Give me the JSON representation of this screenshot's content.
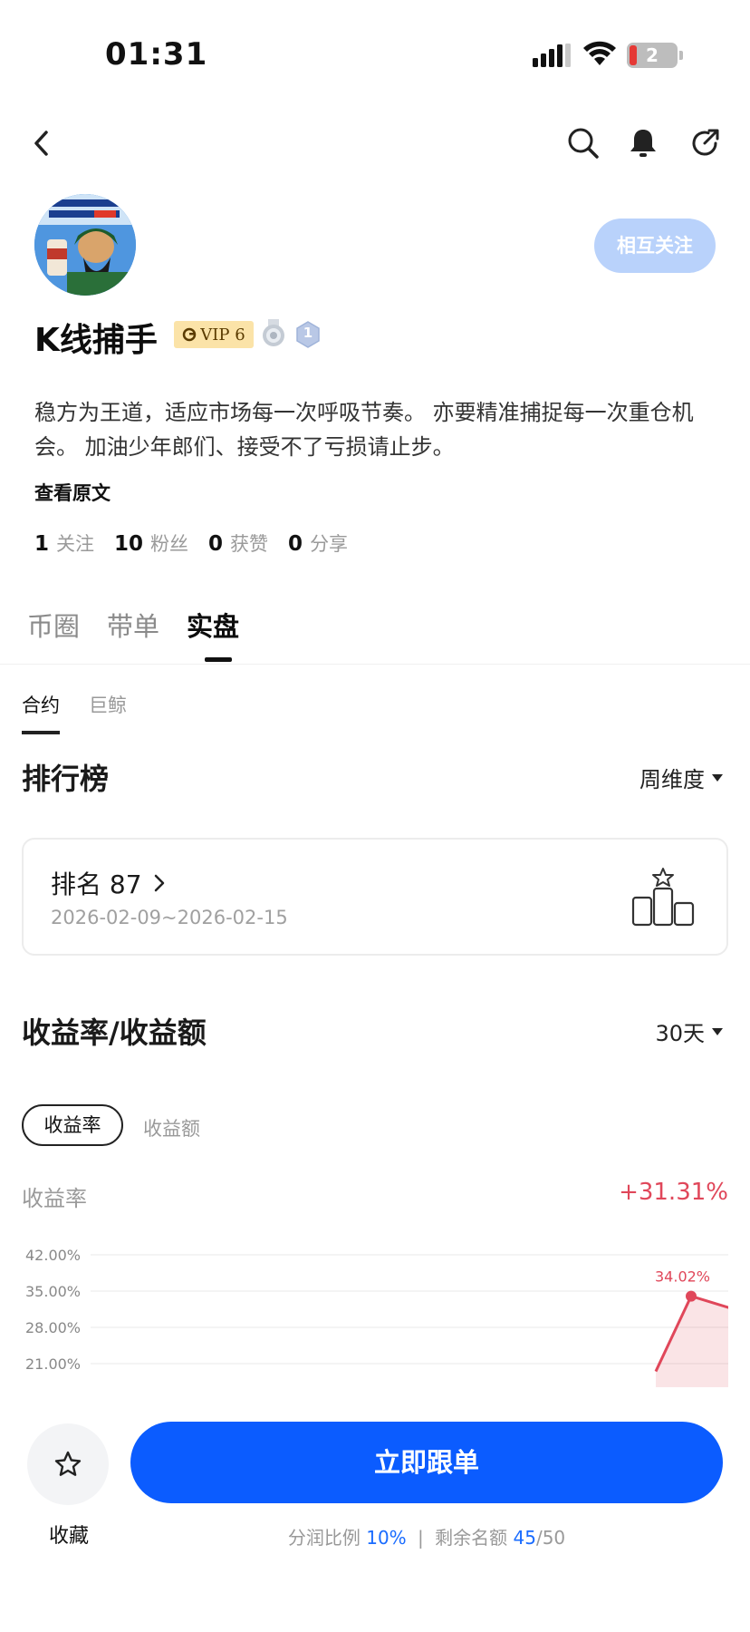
{
  "status_bar": {
    "time": "01:31",
    "battery": "2"
  },
  "profile": {
    "follow_button": "相互关注",
    "username": "K线捕手",
    "vip": "VIP 6",
    "level": "1",
    "bio": "稳方为王道，适应市场每一次呼吸节奏。 亦要精准捕捉每一次重仓机会。 加油少年郎们、接受不了亏损请止步。",
    "view_original": "查看原文",
    "stats": [
      {
        "value": "1",
        "label": "关注"
      },
      {
        "value": "10",
        "label": "粉丝"
      },
      {
        "value": "0",
        "label": "获赞"
      },
      {
        "value": "0",
        "label": "分享"
      }
    ]
  },
  "tabs": [
    "币圈",
    "带单",
    "实盘"
  ],
  "active_tab": "实盘",
  "subtabs": [
    "合约",
    "巨鲸"
  ],
  "ranking": {
    "title": "排行榜",
    "period_select": "周维度",
    "rank_label": "排名 87",
    "date_range": "2026-02-09~2026-02-15"
  },
  "returns": {
    "title": "收益率/收益额",
    "period_select": "30天",
    "toggle_active": "收益率",
    "toggle_other": "收益额",
    "metric_label": "收益率",
    "metric_value": "+31.31%"
  },
  "chart_data": {
    "type": "area",
    "y_ticks": [
      "42.00%",
      "35.00%",
      "28.00%",
      "21.00%"
    ],
    "ylim": [
      21,
      42
    ],
    "peak_label": "34.02%",
    "series": [
      {
        "values": [
          19.5,
          34.02,
          31.31
        ]
      }
    ],
    "color": "#e0475a"
  },
  "bottom": {
    "favorite_label": "收藏",
    "follow_trade_button": "立即跟单",
    "share_ratio_label": "分润比例",
    "share_ratio_value": "10%",
    "separator": "|",
    "remaining_label": "剩余名额",
    "remaining_value": "45",
    "remaining_total": "/50"
  }
}
